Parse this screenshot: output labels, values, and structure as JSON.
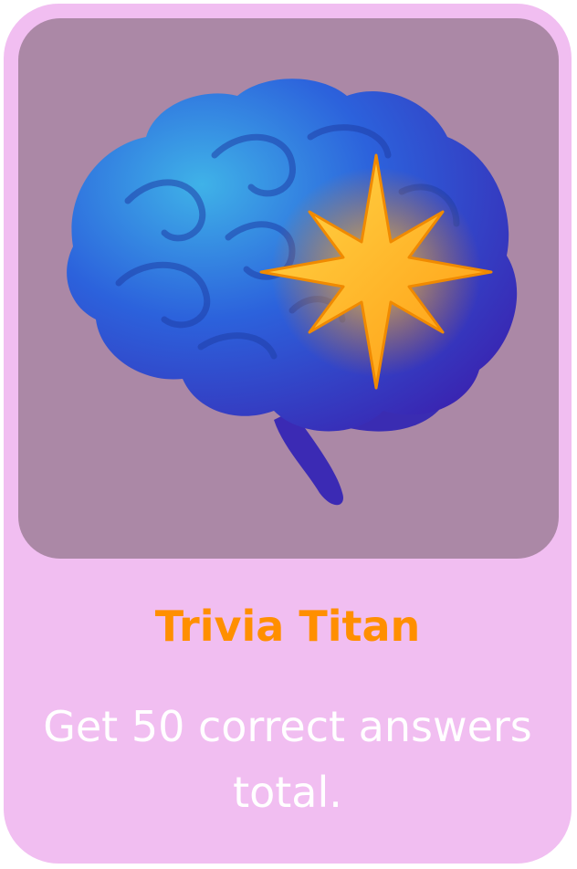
{
  "achievement": {
    "title": "Trivia Titan",
    "description": "Get 50 correct answers total.",
    "icon": "brain-star-icon"
  },
  "colors": {
    "card_background": "#f1bef1",
    "art_background": "#ab88a6",
    "title": "#ff8f00",
    "description": "#ffffff",
    "brain": "#2f5fe0",
    "star": "#ffb21a"
  }
}
